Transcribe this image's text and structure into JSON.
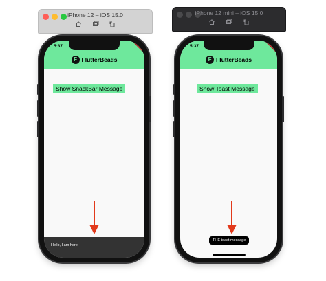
{
  "left_simulator": {
    "window_title": "iPhone 12 – iOS 15.0",
    "toolbar_icons": [
      "home-icon",
      "screenshot-icon",
      "rotate-icon"
    ],
    "status_time": "5:37",
    "app_title": "FlutterBeads",
    "logo_letter": "F",
    "button_label": "Show SnackBar Message",
    "snackbar_text": "Hello, I am here",
    "traffic_lights": {
      "close": "#ff5f57",
      "minimize": "#febc2e",
      "zoom": "#28c840"
    }
  },
  "right_simulator": {
    "window_title": "iPhone 12 mini – iOS 15.0",
    "toolbar_icons": [
      "home-icon",
      "screenshot-icon",
      "rotate-icon"
    ],
    "status_time": "5:37",
    "app_title": "FlutterBeads",
    "logo_letter": "F",
    "button_label": "Show Toast Message",
    "toast_text": "THE toast message",
    "traffic_lights": {
      "close": "#4a4a4c",
      "minimize": "#4a4a4c",
      "zoom": "#4a4a4c"
    }
  },
  "colors": {
    "app_bar": "#6ee89c",
    "button": "#6ee89c",
    "arrow": "#e23a1c",
    "snackbar": "#333333",
    "toast": "#000000",
    "debug_ribbon": "#b3262b"
  }
}
